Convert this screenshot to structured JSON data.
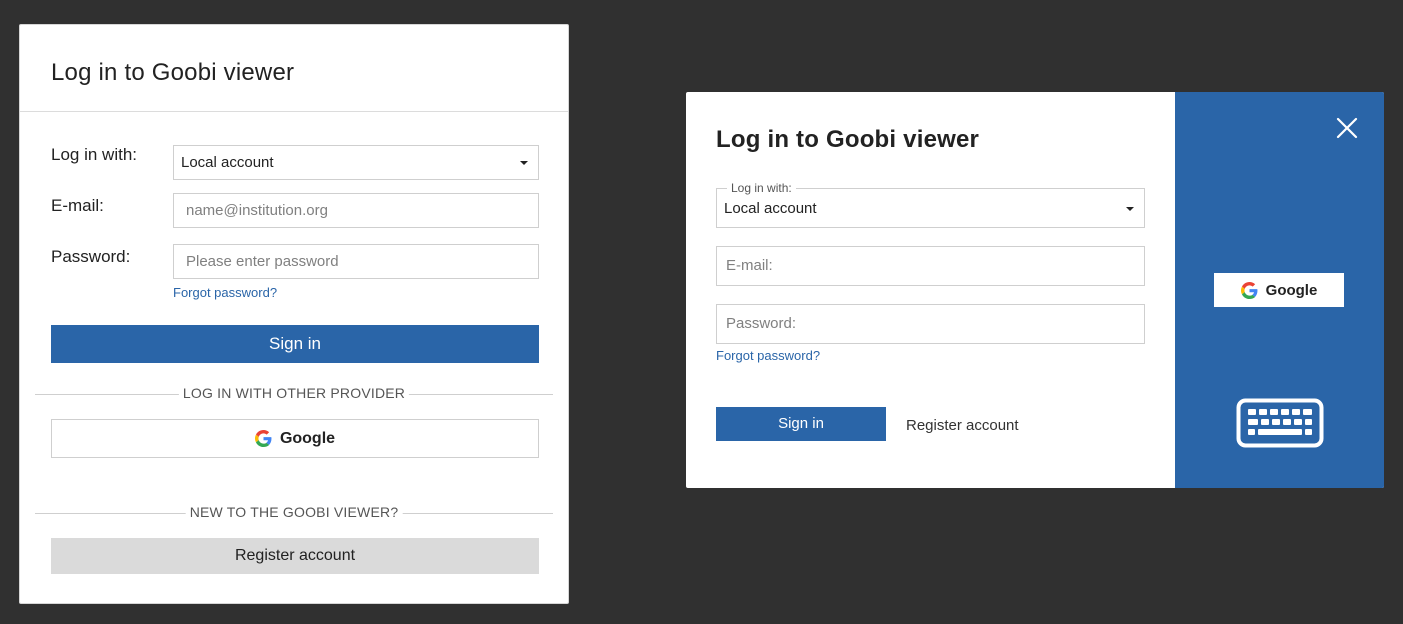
{
  "left_dialog": {
    "title": "Log in to Goobi viewer",
    "login_with_label": "Log in with:",
    "provider_selected": "Local account",
    "email_label": "E-mail:",
    "email_placeholder": "name@institution.org",
    "password_label": "Password:",
    "password_placeholder": "Please enter password",
    "forgot_password": "Forgot password?",
    "sign_in": "Sign in",
    "other_provider_divider": "LOG IN WITH OTHER PROVIDER",
    "google_button": "Google",
    "new_user_divider": "NEW TO THE GOOBI VIEWER?",
    "register_button": "Register account"
  },
  "right_dialog": {
    "title": "Log in to Goobi viewer",
    "login_with_legend": "Log in with:",
    "provider_selected": "Local account",
    "email_placeholder": "E-mail:",
    "password_placeholder": "Password:",
    "forgot_password": "Forgot password?",
    "sign_in": "Sign in",
    "register_button": "Register account",
    "google_button": "Google",
    "icons": [
      "close-icon",
      "google-icon",
      "keyboard-icon"
    ]
  },
  "colors": {
    "background": "#303030",
    "primary": "#2a65a8",
    "link": "#2a65a8",
    "register_gray": "#dadada"
  }
}
